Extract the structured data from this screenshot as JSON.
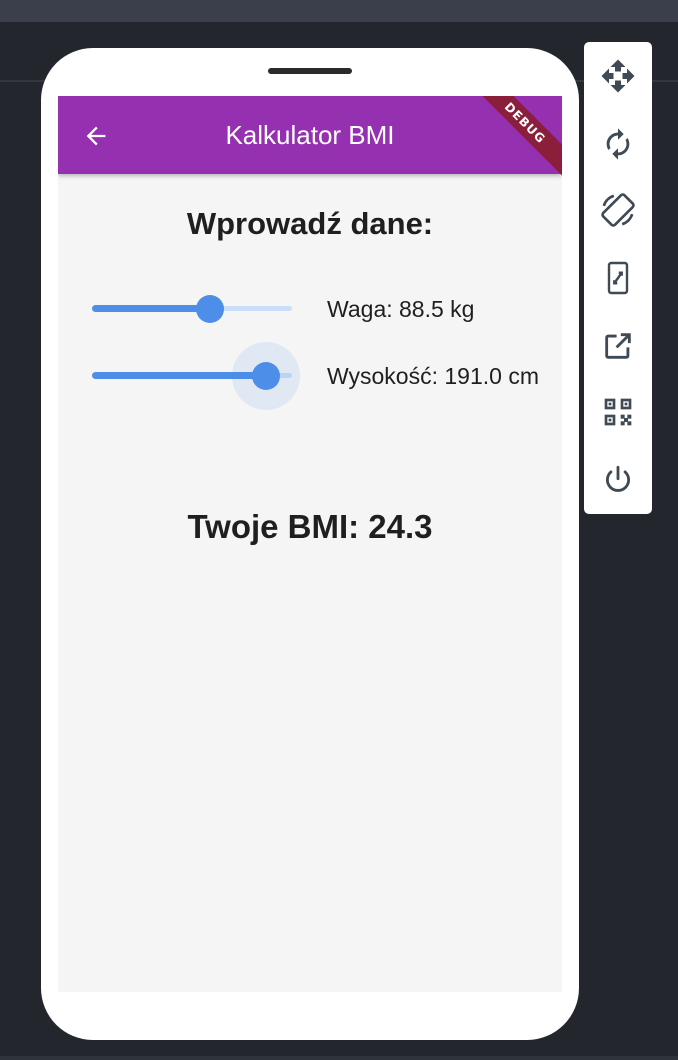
{
  "app": {
    "title": "Kalkulator BMI",
    "debug_banner": "DEBUG",
    "heading": "Wprowadź dane:",
    "result": "Twoje BMI: 24.3"
  },
  "sliders": [
    {
      "label": "Waga: 88.5 kg",
      "value_fraction": 0.59,
      "focused": false
    },
    {
      "label": "Wysokość: 191.0 cm",
      "value_fraction": 0.87,
      "focused": true
    }
  ],
  "toolbar": {
    "icons": [
      "move-icon",
      "rotate-icon",
      "rotate-device-icon",
      "resize-icon",
      "open-external-icon",
      "qr-code-icon",
      "power-icon"
    ]
  },
  "colors": {
    "app_bar": "#9531b0",
    "slider_accent": "#4d8ee8",
    "debug_banner": "#8b1f3b"
  }
}
